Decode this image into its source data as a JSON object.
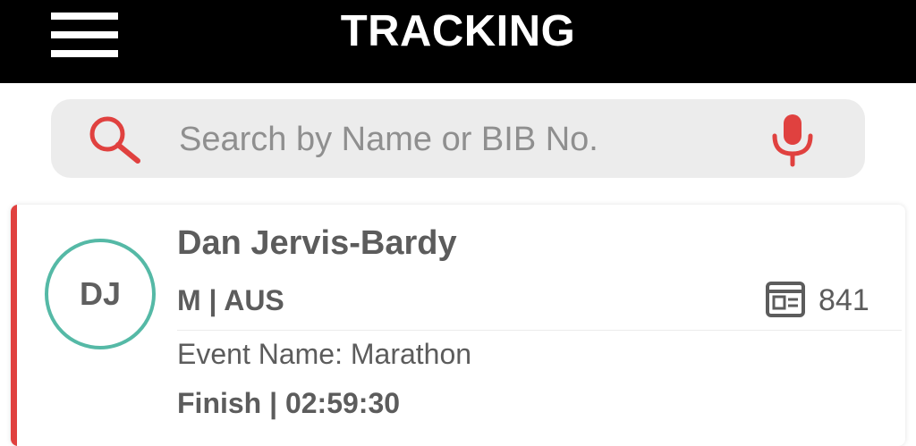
{
  "header": {
    "title": "TRACKING",
    "menu_icon": "hamburger-menu-icon"
  },
  "search": {
    "placeholder": "Search by Name or BIB No.",
    "value": "",
    "search_icon": "search-icon",
    "mic_icon": "microphone-icon"
  },
  "colors": {
    "header_bg": "#000000",
    "accent_red": "#e0413f",
    "avatar_ring": "#55b9a6",
    "search_bg": "#ececec",
    "text": "#5c5c5c"
  },
  "athletes": [
    {
      "initials": "DJ",
      "name": "Dan Jervis-Bardy",
      "gender_country": "M | AUS",
      "bib_icon": "bib-card-icon",
      "bib": "841",
      "event": "Event Name: Marathon",
      "finish": "Finish | 02:59:30"
    }
  ]
}
